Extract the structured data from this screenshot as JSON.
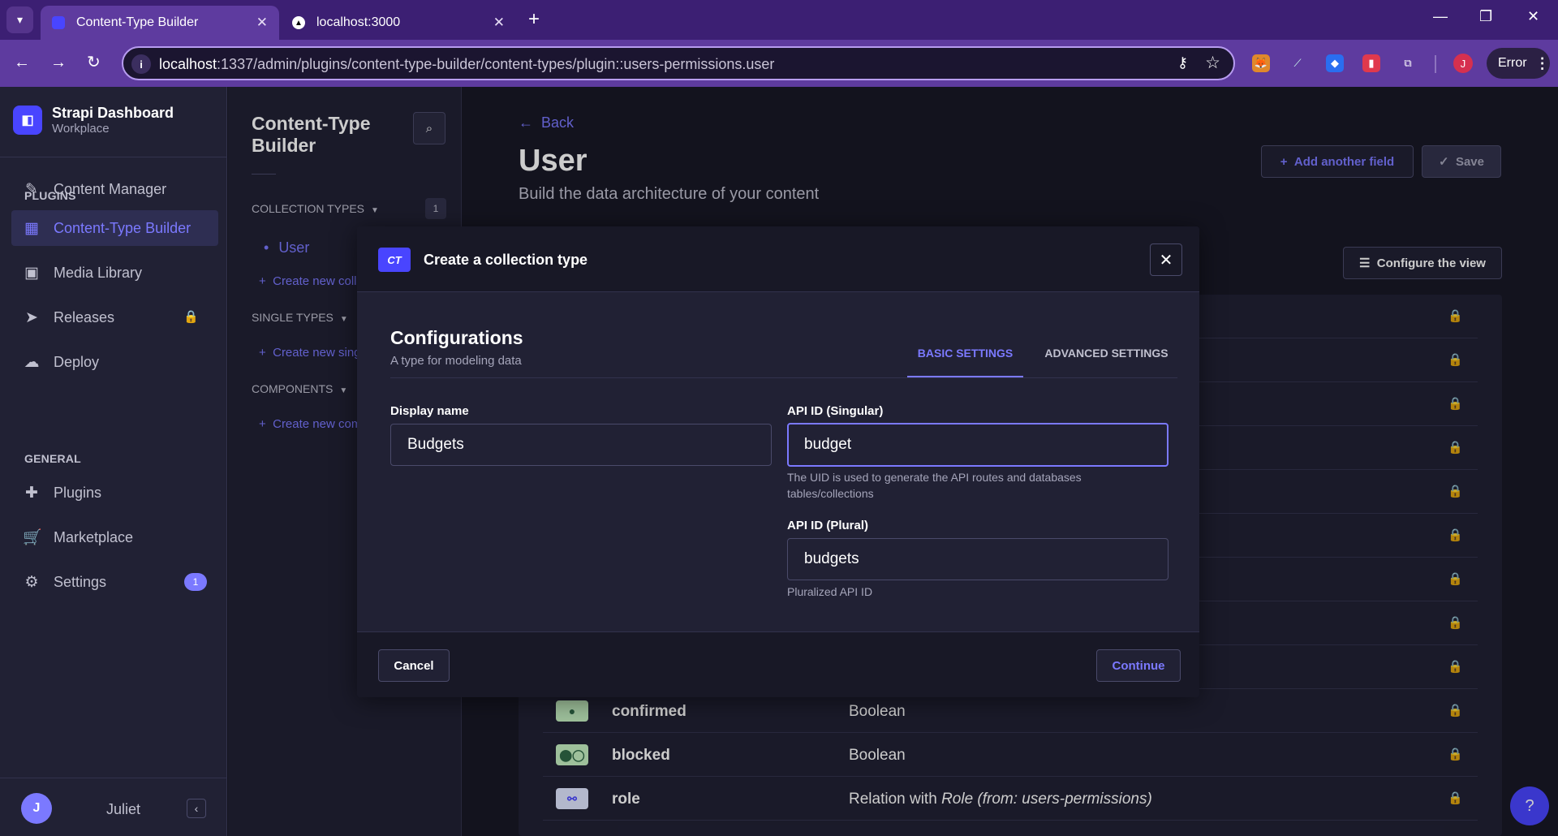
{
  "browser": {
    "tabs": [
      {
        "title": "Content-Type Builder",
        "active": true
      },
      {
        "title": "localhost:3000",
        "active": false
      }
    ],
    "url_host": "localhost",
    "url_rest": ":1337/admin/plugins/content-type-builder/content-types/plugin::users-permissions.user",
    "profile_initial": "J",
    "error_label": "Error"
  },
  "mainnav": {
    "brand_title": "Strapi Dashboard",
    "brand_subtitle": "Workplace",
    "items": [
      {
        "label": "Content Manager",
        "icon": "pencil-icon"
      },
      {
        "label": "Content-Type Builder",
        "icon": "layout-icon",
        "active": true
      },
      {
        "label": "Media Library",
        "icon": "image-icon"
      },
      {
        "label": "Releases",
        "icon": "paper-plane-icon",
        "locked": true
      },
      {
        "label": "Deploy",
        "icon": "cloud-icon"
      },
      {
        "label": "Plugins",
        "icon": "puzzle-icon"
      },
      {
        "label": "Marketplace",
        "icon": "cart-icon"
      },
      {
        "label": "Settings",
        "icon": "gear-icon",
        "badge": "1"
      }
    ],
    "section_plugins": "PLUGINS",
    "section_general": "GENERAL",
    "user_initial": "J",
    "user_name": "Juliet"
  },
  "subnav": {
    "title": "Content-Type Builder",
    "collection_types": "COLLECTION TYPES",
    "collection_count": "1",
    "user_item": "User",
    "create_collection": "Create new coll",
    "single_types": "SINGLE TYPES",
    "create_single": "Create new sing",
    "components": "COMPONENTS",
    "create_component": "Create new com"
  },
  "content": {
    "back": "Back",
    "title": "User",
    "subtitle": "Build the data architecture of your content",
    "add_field": "Add another field",
    "save": "Save",
    "configure_view": "Configure the view",
    "fields": [
      {
        "name": "confirmed",
        "type": "Boolean",
        "icon": "toggle-icon"
      },
      {
        "name": "blocked",
        "type": "Boolean",
        "icon": "toggle-icon"
      },
      {
        "name": "role",
        "type_prefix": "Relation with ",
        "type_em": "Role",
        "type_suffix": " (from: users-permissions)",
        "icon": "relation-icon"
      }
    ]
  },
  "modal": {
    "badge": "CT",
    "title": "Create a collection type",
    "config_title": "Configurations",
    "config_subtitle": "A type for modeling data",
    "tab_basic": "BASIC SETTINGS",
    "tab_advanced": "ADVANCED SETTINGS",
    "display_name_label": "Display name",
    "display_name_value": "Budgets",
    "api_singular_label": "API ID (Singular)",
    "api_singular_value": "budget",
    "api_singular_hint": "The UID is used to generate the API routes and databases tables/collections",
    "api_plural_label": "API ID (Plural)",
    "api_plural_value": "budgets",
    "api_plural_hint": "Pluralized API ID",
    "cancel": "Cancel",
    "continue": "Continue"
  }
}
